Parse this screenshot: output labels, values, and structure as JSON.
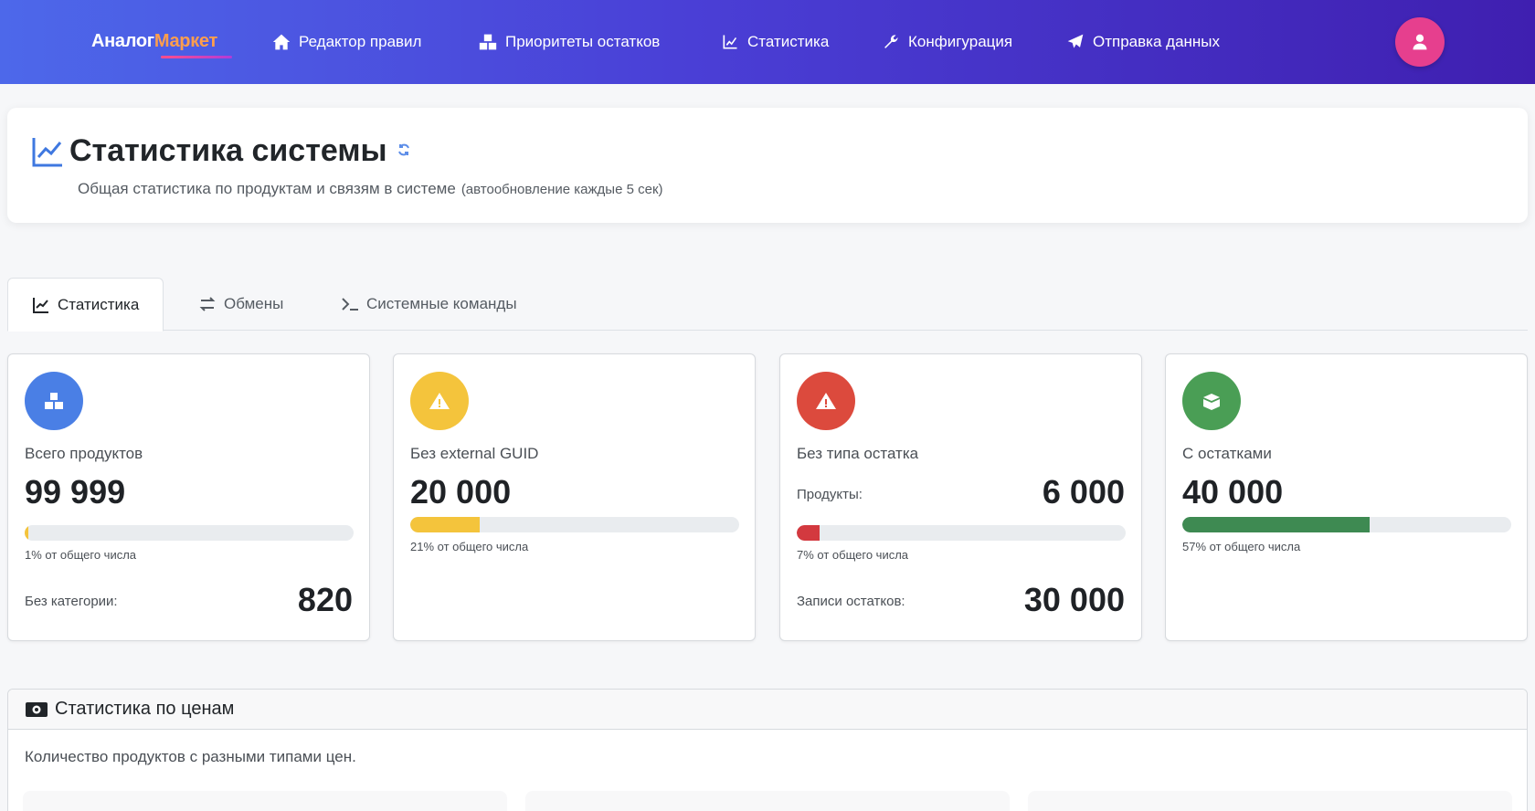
{
  "brand": {
    "part1": "Аналог",
    "part2": "Маркет"
  },
  "nav": {
    "items": [
      {
        "label": "Редактор правил",
        "icon": "home-icon"
      },
      {
        "label": "Приоритеты остатков",
        "icon": "boxes-icon"
      },
      {
        "label": "Статистика",
        "icon": "chart-line-icon"
      },
      {
        "label": "Конфигурация",
        "icon": "wrench-icon"
      },
      {
        "label": "Отправка данных",
        "icon": "paper-plane-icon"
      }
    ],
    "avatar_icon": "user-icon"
  },
  "header": {
    "title": "Статистика системы",
    "subtitle": "Общая статистика по продуктам и связям в системе",
    "autorefresh": "(автообновление каждые 5 сек)"
  },
  "tabs": [
    {
      "label": "Статистика",
      "icon": "chart-line-icon",
      "active": true
    },
    {
      "label": "Обмены",
      "icon": "exchange-icon",
      "active": false
    },
    {
      "label": "Системные команды",
      "icon": "terminal-icon",
      "active": false
    }
  ],
  "stats": [
    {
      "label": "Всего продуктов",
      "value": "99 999",
      "color": "#4a7fe5",
      "icon": "boxes-icon",
      "progress": 1,
      "bar_color": "#f4c43c",
      "caption": "1% от общего числа",
      "extra_label": "Без категории:",
      "extra_value": "820"
    },
    {
      "label": "Без external GUID",
      "value": "20 000",
      "color": "#f4c43c",
      "icon": "warning-icon",
      "progress": 21,
      "bar_color": "#f4c43c",
      "caption": "21% от общего числа"
    },
    {
      "label": "Без типа остатка",
      "products_label": "Продукты:",
      "products_value": "6 000",
      "color": "#dc4a3d",
      "icon": "warning-icon",
      "progress": 7,
      "bar_color": "#d3393f",
      "caption": "7% от общего числа",
      "extra_label": "Записи остатков:",
      "extra_value": "30 000"
    },
    {
      "label": "С остатками",
      "value": "40 000",
      "color": "#4a9e55",
      "icon": "box-open-icon",
      "progress": 57,
      "bar_color": "#3e8a52",
      "caption": "57% от общего числа"
    }
  ],
  "price": {
    "title": "Статистика по ценам",
    "icon": "money-bill-icon",
    "description": "Количество продуктов с разными типами цен."
  }
}
